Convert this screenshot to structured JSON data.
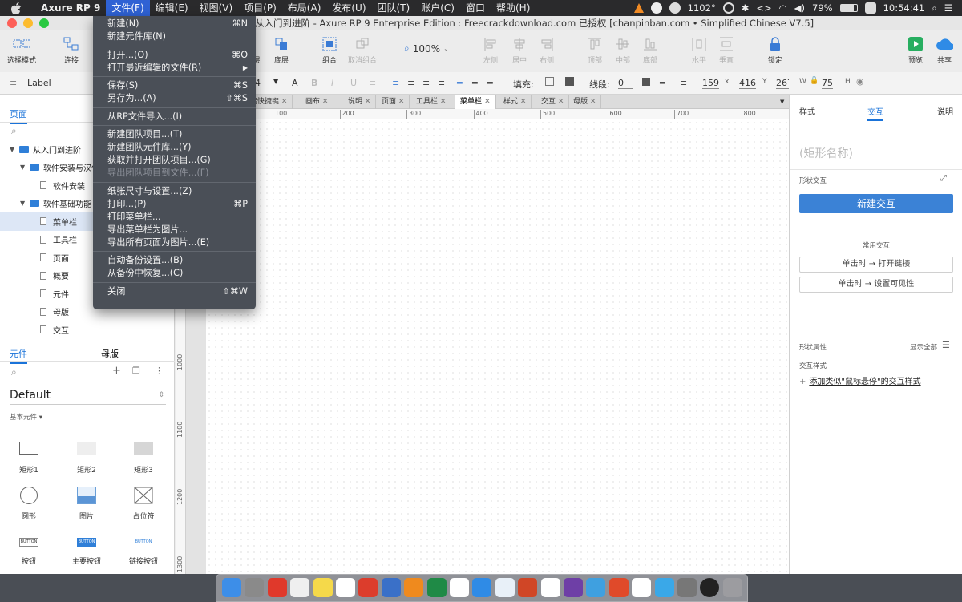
{
  "menubar": {
    "app": "Axure RP 9",
    "items": [
      "文件(F)",
      "编辑(E)",
      "视图(V)",
      "项目(P)",
      "布局(A)",
      "发布(U)",
      "团队(T)",
      "账户(C)",
      "窗口",
      "帮助(H)"
    ],
    "right": {
      "pressure": "1102°",
      "battery": "79%",
      "time": "10:54:41"
    }
  },
  "window": {
    "title": "从入门到进阶 - Axure RP 9 Enterprise Edition : Freecrackdownload.com 已授权     [chanpinban.com • Simplified Chinese V7.5]"
  },
  "toolbar": {
    "select": "选择模式",
    "connect": "连接",
    "bottom": "底层",
    "top": "顶层",
    "group": "组合",
    "ungroup": "取消组合",
    "zoom": "100%",
    "left": "左侧",
    "center": "居中",
    "right": "右侧",
    "top_align": "顶部",
    "middle": "中部",
    "bottom_align": "底部",
    "horizontal": "水平",
    "vertical": "垂直",
    "lock": "锁定",
    "preview": "预览",
    "share": "共享"
  },
  "format": {
    "label": "Label",
    "fontsize": "4",
    "fill": "填充:",
    "line": "线段:",
    "line_val": "0",
    "x": "159",
    "x_lbl": "x",
    "y": "416",
    "y_lbl": "Y",
    "w": "267",
    "w_lbl": "W",
    "h": "75",
    "h_lbl": "H"
  },
  "pages_panel": {
    "tab": "页面",
    "search": "",
    "tree": [
      {
        "label": "从入门到进阶",
        "type": "folder",
        "level": 0
      },
      {
        "label": "软件安装与汉化",
        "type": "folder",
        "level": 1
      },
      {
        "label": "软件安装",
        "type": "page",
        "level": 2
      },
      {
        "label": "软件基础功能",
        "type": "folder",
        "level": 1
      },
      {
        "label": "菜单栏",
        "type": "page",
        "level": 2,
        "selected": true
      },
      {
        "label": "工具栏",
        "type": "page",
        "level": 2
      },
      {
        "label": "页面",
        "type": "page",
        "level": 2
      },
      {
        "label": "概要",
        "type": "page",
        "level": 2
      },
      {
        "label": "元件",
        "type": "page",
        "level": 2
      },
      {
        "label": "母版",
        "type": "page",
        "level": 2
      },
      {
        "label": "交互",
        "type": "page",
        "level": 2
      }
    ]
  },
  "widgets_panel": {
    "tab_widgets": "元件",
    "tab_masters": "母版",
    "library": "Default",
    "section": "基本元件 ▾",
    "items": [
      "矩形1",
      "矩形2",
      "矩形3",
      "圆形",
      "图片",
      "占位符",
      "按钮",
      "主要按钮",
      "链接按钮"
    ],
    "button_text": "BUTTON"
  },
  "canvas": {
    "tabs": [
      "单键快捷键",
      "画布",
      "说明",
      "页面",
      "工具栏",
      "菜单栏",
      "样式",
      "交互",
      "母版"
    ],
    "active_tab": "菜单栏",
    "hruler": [
      "100",
      "200",
      "300",
      "400",
      "500",
      "600",
      "700",
      "800"
    ],
    "vruler": [
      "1000",
      "1100",
      "1200",
      "1300"
    ]
  },
  "right_panel": {
    "tabs": [
      "样式",
      "交互",
      "说明"
    ],
    "active": "交互",
    "shape_name": "(矩形名称)",
    "shape_interactions": "形状交互",
    "new_interaction": "新建交互",
    "common": "常用交互",
    "link": "单击时 → 打开链接",
    "visibility": "单击时 → 设置可见性",
    "props": "形状属性",
    "show_all": "显示全部",
    "interaction_style": "交互样式",
    "add_style": "添加类似\"鼠标悬停\"的交互样式"
  },
  "file_menu": {
    "items": [
      {
        "label": "新建(N)",
        "sc": "⌘N"
      },
      {
        "label": "新建元件库(N)",
        "sc": ""
      },
      {
        "label": "打开...(O)",
        "sc": "⌘O"
      },
      {
        "label": "打开最近编辑的文件(R)",
        "sc": "▶"
      },
      {
        "label": "保存(S)",
        "sc": "⌘S"
      },
      {
        "label": "另存为...(A)",
        "sc": "⇧⌘S"
      },
      {
        "label": "从RP文件导入...(I)",
        "sc": ""
      },
      {
        "label": "新建团队项目...(T)",
        "sc": ""
      },
      {
        "label": "新建团队元件库...(Y)",
        "sc": ""
      },
      {
        "label": "获取并打开团队项目...(G)",
        "sc": ""
      },
      {
        "label": "导出团队项目到文件...(F)",
        "sc": "",
        "disabled": true
      },
      {
        "label": "纸张尺寸与设置...(Z)",
        "sc": ""
      },
      {
        "label": "打印...(P)",
        "sc": "⌘P"
      },
      {
        "label": "打印菜单栏...",
        "sc": ""
      },
      {
        "label": "导出菜单栏为图片...",
        "sc": ""
      },
      {
        "label": "导出所有页面为图片...(E)",
        "sc": ""
      },
      {
        "label": "自动备份设置...(B)",
        "sc": ""
      },
      {
        "label": "从备份中恢复...(C)",
        "sc": ""
      },
      {
        "label": "关闭",
        "sc": "⇧⌘W"
      }
    ]
  },
  "colors": {
    "accent": "#2f7fd8",
    "menu_bg": "#4a4f57",
    "highlight": "#2f62d4"
  }
}
